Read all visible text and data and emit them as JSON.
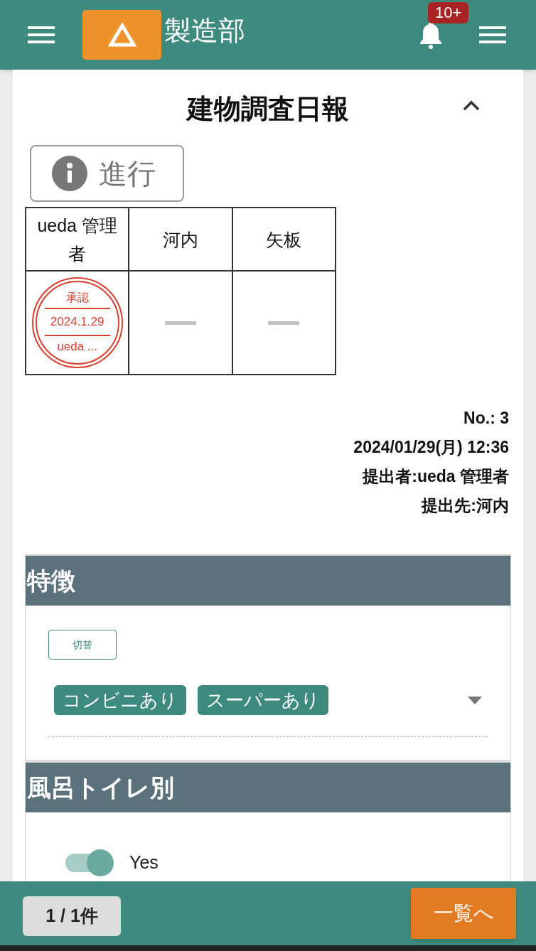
{
  "header": {
    "title": "製造部",
    "notification_count": "10+"
  },
  "report": {
    "title": "建物調査日報",
    "expanded": true,
    "status": "進行",
    "approvals": [
      {
        "name": "ueda 管理者",
        "stamp": {
          "label": "承認",
          "date": "2024.1.29",
          "signer": "ueda ..."
        }
      },
      {
        "name": "河内"
      },
      {
        "name": "矢板"
      }
    ],
    "meta": [
      "No.: 3",
      "2024/01/29(月) 12:36",
      "提出者:ueda 管理者",
      "提出先:河内"
    ]
  },
  "sections": [
    {
      "title": "特徴",
      "kind": "tags",
      "toggle_button": "切替",
      "tags": [
        "コンビニあり",
        "スーパーあり"
      ]
    },
    {
      "title": "風呂トイレ別",
      "kind": "switch",
      "on": true,
      "label": "Yes"
    }
  ],
  "footer": {
    "pager": "1 / 1件",
    "list_button": "一覧へ"
  }
}
